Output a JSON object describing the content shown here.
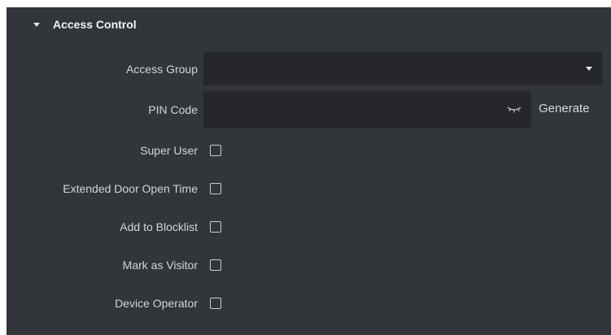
{
  "section": {
    "title": "Access Control"
  },
  "fields": {
    "access_group": {
      "label": "Access Group",
      "value": ""
    },
    "pin_code": {
      "label": "PIN Code",
      "value": "",
      "action_label": "Generate"
    }
  },
  "checkboxes": [
    {
      "label": "Super User",
      "checked": false
    },
    {
      "label": "Extended Door Open Time",
      "checked": false
    },
    {
      "label": "Add to Blocklist",
      "checked": false
    },
    {
      "label": "Mark as Visitor",
      "checked": false
    },
    {
      "label": "Device Operator",
      "checked": false
    }
  ],
  "colors": {
    "panel_bg": "#323539",
    "field_bg": "#25272a",
    "text": "#d6d8da"
  },
  "icons": {
    "section_toggle": "caret-down-icon",
    "dropdown": "chevron-down-icon",
    "password_visibility": "eye-closed-icon"
  }
}
